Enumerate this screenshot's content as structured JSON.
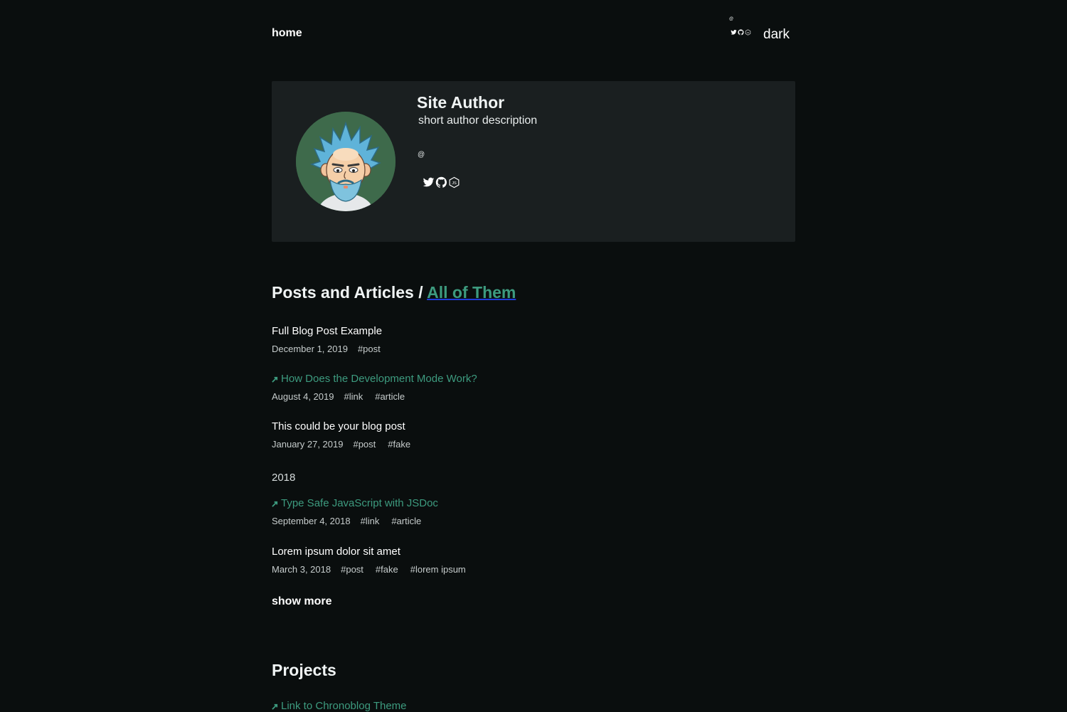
{
  "nav": {
    "home_label": "home",
    "theme_toggle_label": "dark",
    "handle_symbol": "@"
  },
  "author": {
    "name": "Site Author",
    "description": "short author description",
    "handle_symbol": "@",
    "social_icons": [
      "twitter-icon",
      "github-icon",
      "nodejs-icon"
    ]
  },
  "posts_section": {
    "title": "Posts and Articles / ",
    "all_link": "All of Them"
  },
  "posts": [
    {
      "title": "Full Blog Post Example",
      "is_link": false,
      "date": "December 1, 2019",
      "tags": [
        "#post"
      ]
    },
    {
      "title": "How Does the Development Mode Work?",
      "is_link": true,
      "date": "August 4, 2019",
      "tags": [
        "#link",
        "#article"
      ]
    },
    {
      "title": "This could be your blog post",
      "is_link": false,
      "date": "January 27, 2019",
      "tags": [
        "#post",
        "#fake"
      ]
    },
    {
      "title": "Type Safe JavaScript with JSDoc",
      "is_link": true,
      "date": "September 4, 2018",
      "tags": [
        "#link",
        "#article"
      ]
    },
    {
      "title": "Lorem ipsum dolor sit amet",
      "is_link": false,
      "date": "March 3, 2018",
      "tags": [
        "#post",
        "#fake",
        "#lorem ipsum"
      ]
    }
  ],
  "year_heading": "2018",
  "show_more_label": "show more",
  "projects": {
    "title": "Projects",
    "items": [
      {
        "title": "Link to Chronoblog Theme",
        "is_link": true
      }
    ]
  },
  "colors": {
    "background": "#0a0e0e",
    "card": "#1a1f20",
    "accent": "#3d9b7f",
    "avatar_bg": "#3e6a4b"
  }
}
